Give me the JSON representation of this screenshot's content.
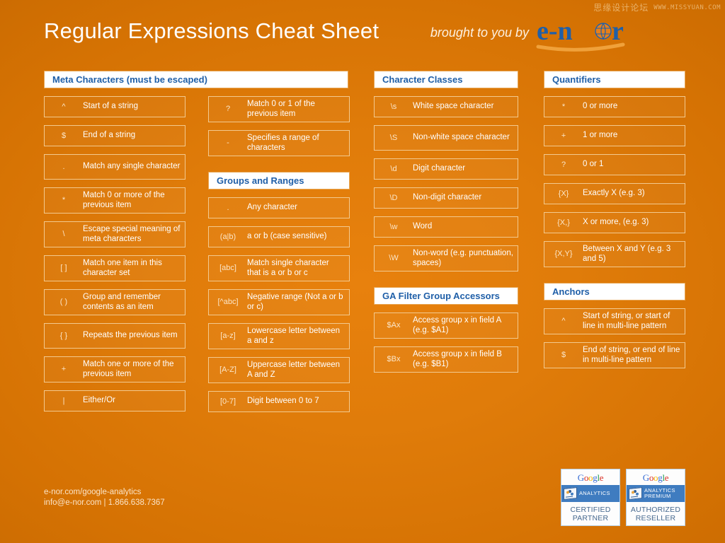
{
  "watermark": {
    "chinese": "思缘设计论坛",
    "url": "WWW.MISSYUAN.COM"
  },
  "header": {
    "title": "Regular Expressions Cheat Sheet",
    "brought_by": "brought to you by",
    "logo_text": "e-nor"
  },
  "colors": {
    "background": "#d97407",
    "section_title_text": "#1f5fa8",
    "entry_border": "#f3c98e",
    "logo_blue": "#1f5fa8",
    "logo_orange": "#e8801a"
  },
  "sections": {
    "meta_characters": {
      "title": "Meta Characters (must be escaped)",
      "items_left": [
        {
          "symbol": "^",
          "desc": "Start of a string"
        },
        {
          "symbol": "$",
          "desc": "End of a string"
        },
        {
          "symbol": ".",
          "desc": "Match any single character"
        },
        {
          "symbol": "*",
          "desc": "Match 0 or more of the previous item"
        },
        {
          "symbol": "\\",
          "desc": "Escape special meaning of meta characters"
        },
        {
          "symbol": "[ ]",
          "desc": "Match one item in this character set"
        },
        {
          "symbol": "( )",
          "desc": "Group and remember contents as an item"
        },
        {
          "symbol": "{ }",
          "desc": "Repeats the previous item"
        },
        {
          "symbol": "+",
          "desc": "Match one or more of the previous item"
        },
        {
          "symbol": "|",
          "desc": "Either/Or"
        }
      ],
      "items_right": [
        {
          "symbol": "?",
          "desc": "Match 0 or 1 of the previous item"
        },
        {
          "symbol": "-",
          "desc": "Specifies a range of characters"
        }
      ]
    },
    "groups_and_ranges": {
      "title": "Groups and Ranges",
      "items": [
        {
          "symbol": ".",
          "desc": "Any character"
        },
        {
          "symbol": "(a|b)",
          "desc": "a or b (case sensitive)"
        },
        {
          "symbol": "[abc]",
          "desc": "Match single character that is a or b or c"
        },
        {
          "symbol": "[^abc]",
          "desc": "Negative range (Not a or b or c)"
        },
        {
          "symbol": "[a-z]",
          "desc": "Lowercase letter between a and z"
        },
        {
          "symbol": "[A-Z]",
          "desc": "Uppercase letter between A and Z"
        },
        {
          "symbol": "[0-7]",
          "desc": "Digit between 0 to 7"
        }
      ]
    },
    "character_classes": {
      "title": "Character Classes",
      "items": [
        {
          "symbol": "\\s",
          "desc": "White space character"
        },
        {
          "symbol": "\\S",
          "desc": "Non-white space character"
        },
        {
          "symbol": "\\d",
          "desc": "Digit character"
        },
        {
          "symbol": "\\D",
          "desc": "Non-digit character"
        },
        {
          "symbol": "\\w",
          "desc": "Word"
        },
        {
          "symbol": "\\W",
          "desc": "Non-word (e.g. punctuation, spaces)"
        }
      ]
    },
    "ga_filter_group_accessors": {
      "title": "GA Filter Group Accessors",
      "items": [
        {
          "symbol": "$Ax",
          "desc": "Access group x in field A (e.g. $A1)"
        },
        {
          "symbol": "$Bx",
          "desc": "Access group x in field B (e.g. $B1)"
        }
      ]
    },
    "quantifiers": {
      "title": "Quantifiers",
      "items": [
        {
          "symbol": "*",
          "desc": "0 or more"
        },
        {
          "symbol": "+",
          "desc": "1 or more"
        },
        {
          "symbol": "?",
          "desc": "0 or 1"
        },
        {
          "symbol": "{X}",
          "desc": "Exactly X (e.g. 3)"
        },
        {
          "symbol": "{X,}",
          "desc": "X or more, (e.g. 3)"
        },
        {
          "symbol": "{X,Y}",
          "desc": "Between X and Y (e.g. 3 and 5)"
        }
      ]
    },
    "anchors": {
      "title": "Anchors",
      "items": [
        {
          "symbol": "^",
          "desc": "Start of string, or start of line in multi-line pattern"
        },
        {
          "symbol": "$",
          "desc": "End of string, or end of line in multi-line pattern"
        }
      ]
    }
  },
  "footer": {
    "website": "e-nor.com/google-analytics",
    "contact": "info@e-nor.com | 1.866.638.7367",
    "badges": [
      {
        "brand": "Google",
        "strip": "ANALYTICS",
        "role_line1": "CERTIFIED",
        "role_line2": "PARTNER"
      },
      {
        "brand": "Google",
        "strip": "ANALYTICS PREMIUM",
        "role_line1": "AUTHORIZED",
        "role_line2": "RESELLER"
      }
    ]
  }
}
